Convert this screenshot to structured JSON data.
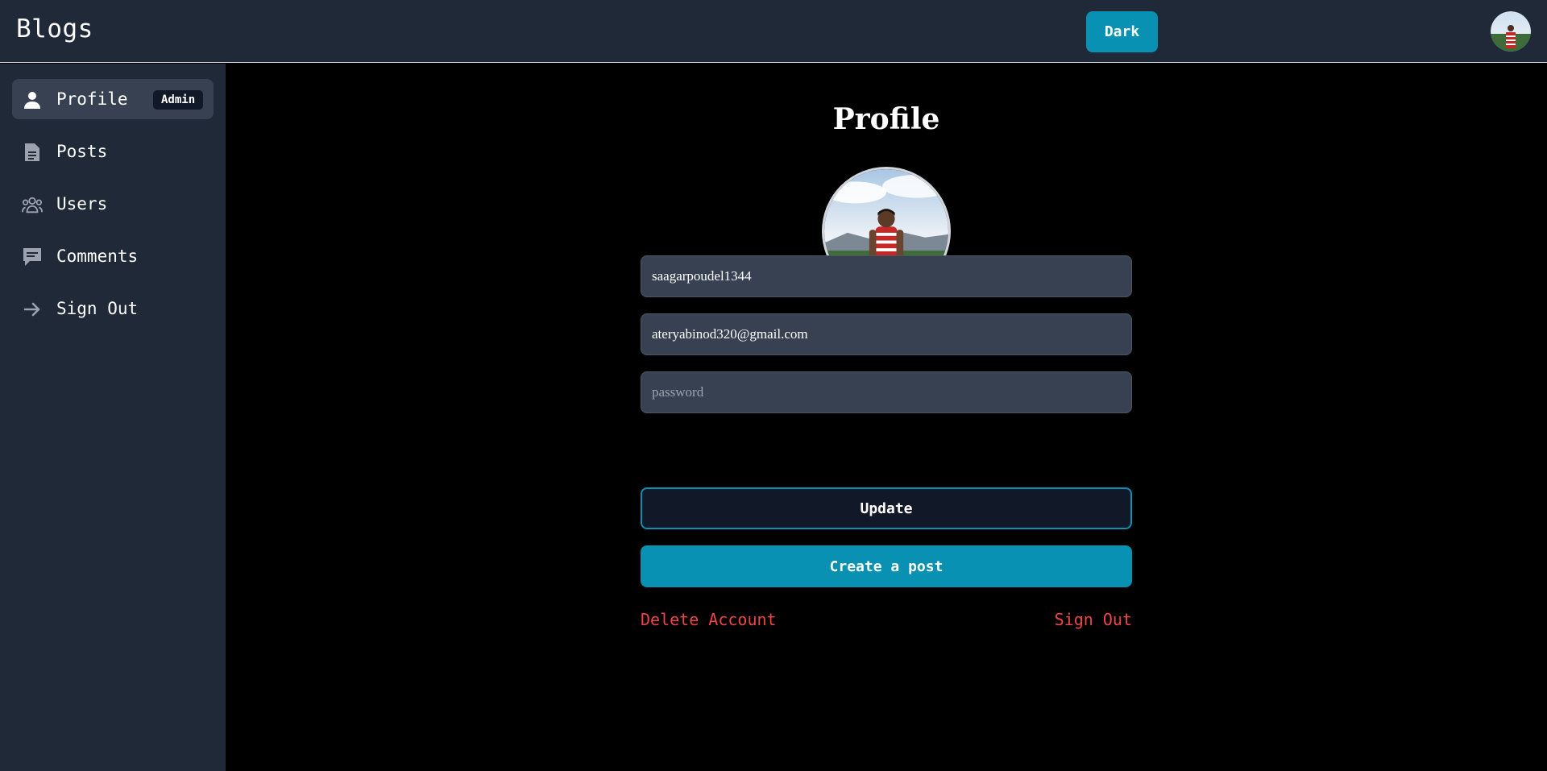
{
  "header": {
    "brand": "Blogs",
    "theme_button": "Dark",
    "avatar_icon": "user-avatar-photo"
  },
  "sidebar": {
    "items": [
      {
        "label": "Profile",
        "icon": "person-icon",
        "badge": "Admin",
        "active": true
      },
      {
        "label": "Posts",
        "icon": "document-icon"
      },
      {
        "label": "Users",
        "icon": "users-group-icon"
      },
      {
        "label": "Comments",
        "icon": "comment-icon"
      },
      {
        "label": "Sign Out",
        "icon": "arrow-right-icon"
      }
    ]
  },
  "main": {
    "title": "Profile",
    "username_value": "saagarpoudel1344",
    "email_value": "ateryabinod320@gmail.com",
    "password_placeholder": "password",
    "update_label": "Update",
    "create_post_label": "Create a post",
    "delete_account_label": "Delete Account",
    "sign_out_label": "Sign Out"
  },
  "colors": {
    "accent": "#0891b2",
    "panel": "#1f2937",
    "danger": "#ef4444"
  }
}
